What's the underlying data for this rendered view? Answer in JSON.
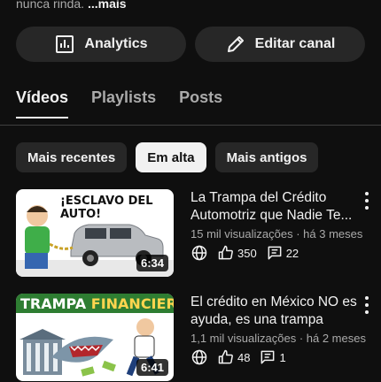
{
  "channel": {
    "description_tail": "nunca rinda.",
    "more_link": "...mais"
  },
  "actions": {
    "analytics_label": "Analytics",
    "edit_label": "Editar canal"
  },
  "tabs": [
    {
      "label": "Vídeos",
      "active": true
    },
    {
      "label": "Playlists",
      "active": false
    },
    {
      "label": "Posts",
      "active": false
    }
  ],
  "chips": [
    {
      "label": "Mais recentes",
      "active": false
    },
    {
      "label": "Em alta",
      "active": true
    },
    {
      "label": "Mais antigos",
      "active": false
    }
  ],
  "videos": [
    {
      "title": "La Trampa del Crédito Automotriz que Nadie Te...",
      "meta": "15 mil visualizações · há 3 meses",
      "duration": "6:34",
      "likes": "350",
      "comments": "22",
      "thumb_text": "¡ESCLAVO DEL AUTO!"
    },
    {
      "title": "El crédito en México NO es ayuda, es una trampa",
      "meta": "1,1 mil visualizações · há 2 meses",
      "duration": "6:41",
      "likes": "48",
      "comments": "1",
      "thumb_text_a": "TRAMPA",
      "thumb_text_b": "FINANCIERA"
    }
  ],
  "icons": {
    "analytics": "bar-chart-icon",
    "edit": "pencil-icon",
    "visibility": "globe-icon",
    "like": "thumbs-up-icon",
    "comment": "comment-icon",
    "menu": "more-vertical-icon"
  }
}
